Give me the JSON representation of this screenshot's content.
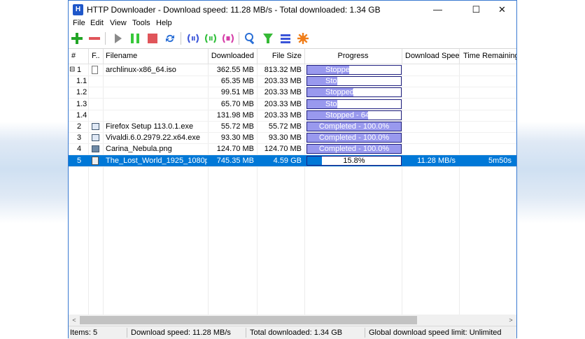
{
  "window": {
    "title": "HTTP Downloader - Download speed: 11.28 MB/s - Total downloaded: 1.34 GB",
    "app_icon_text": "H",
    "controls": {
      "minimize": "—",
      "maximize": "☐",
      "close": "✕"
    }
  },
  "menu": [
    "File",
    "Edit",
    "View",
    "Tools",
    "Help"
  ],
  "toolbar": [
    {
      "icon": "add-icon",
      "color": "#22a526"
    },
    {
      "icon": "remove-icon",
      "color": "#e0555a"
    },
    {
      "icon": "start-icon",
      "color": "#8a8a8a"
    },
    {
      "icon": "pause-icon",
      "color": "#37c83a"
    },
    {
      "icon": "stop-icon",
      "color": "#e0555a"
    },
    {
      "icon": "restart-icon",
      "color": "#2a6fd6"
    },
    {
      "icon": "pause-active-icon",
      "color": "#3b55d9"
    },
    {
      "icon": "start-queue-icon",
      "color": "#2fbf3a"
    },
    {
      "icon": "stop-queue-icon",
      "color": "#d63ea8"
    },
    {
      "icon": "search-icon",
      "color": "#2a6fd6"
    },
    {
      "icon": "filter-icon",
      "color": "#35b935"
    },
    {
      "icon": "queue-icon",
      "color": "#3b55d9"
    },
    {
      "icon": "options-icon",
      "color": "#f07e1a"
    }
  ],
  "columns": [
    "#",
    "F..",
    "Filename",
    "Downloaded",
    "File Size",
    "Progress",
    "Download Speed",
    "Time Remaining"
  ],
  "rows": [
    {
      "num": "1",
      "expander": "⊟",
      "filename": "archlinux-x86_64.iso",
      "downloaded": "362.55 MB",
      "size": "813.32 MB",
      "progress": 44.5,
      "progress_label": "Stopped - 44.5%",
      "speed": "",
      "remaining": "",
      "icon": "file-iso-icon",
      "selected": false
    },
    {
      "num": "1.1",
      "expander": "",
      "filename": "",
      "downloaded": "65.35 MB",
      "size": "203.33 MB",
      "progress": 32.1,
      "progress_label": "Stopped - 32.1%",
      "speed": "",
      "remaining": "",
      "icon": "",
      "selected": false
    },
    {
      "num": "1.2",
      "expander": "",
      "filename": "",
      "downloaded": "99.51 MB",
      "size": "203.33 MB",
      "progress": 48.9,
      "progress_label": "Stopped - 48.9%",
      "speed": "",
      "remaining": "",
      "icon": "",
      "selected": false
    },
    {
      "num": "1.3",
      "expander": "",
      "filename": "",
      "downloaded": "65.70 MB",
      "size": "203.33 MB",
      "progress": 32.3,
      "progress_label": "Stopped - 32.3%",
      "speed": "",
      "remaining": "",
      "icon": "",
      "selected": false
    },
    {
      "num": "1.4",
      "expander": "",
      "filename": "",
      "downloaded": "131.98 MB",
      "size": "203.33 MB",
      "progress": 64.9,
      "progress_label": "Stopped - 64.9%",
      "speed": "",
      "remaining": "",
      "icon": "",
      "selected": false
    },
    {
      "num": "2",
      "expander": "",
      "filename": "Firefox Setup 113.0.1.exe",
      "downloaded": "55.72 MB",
      "size": "55.72 MB",
      "progress": 100.0,
      "progress_label": "Completed - 100.0%",
      "speed": "",
      "remaining": "",
      "icon": "file-exe-icon",
      "selected": false
    },
    {
      "num": "3",
      "expander": "",
      "filename": "Vivaldi.6.0.2979.22.x64.exe",
      "downloaded": "93.30 MB",
      "size": "93.30 MB",
      "progress": 100.0,
      "progress_label": "Completed - 100.0%",
      "speed": "",
      "remaining": "",
      "icon": "file-exe-icon",
      "selected": false
    },
    {
      "num": "4",
      "expander": "",
      "filename": "Carina_Nebula.png",
      "downloaded": "124.70 MB",
      "size": "124.70 MB",
      "progress": 100.0,
      "progress_label": "Completed - 100.0%",
      "speed": "",
      "remaining": "",
      "icon": "file-image-icon",
      "selected": false
    },
    {
      "num": "5",
      "expander": "",
      "filename": "The_Lost_World_1925_1080p.mkv",
      "downloaded": "745.35 MB",
      "size": "4.59 GB",
      "progress": 15.8,
      "progress_label": "15.8%",
      "speed": "11.28 MB/s",
      "remaining": "5m50s",
      "icon": "file-video-icon",
      "selected": true
    }
  ],
  "scrollbar": {
    "left": "<",
    "right": ">"
  },
  "status": {
    "items": "Items: 5",
    "speed": "Download speed: 11.28 MB/s",
    "total": "Total downloaded: 1.34 GB",
    "limit": "Global download speed limit: Unlimited"
  }
}
